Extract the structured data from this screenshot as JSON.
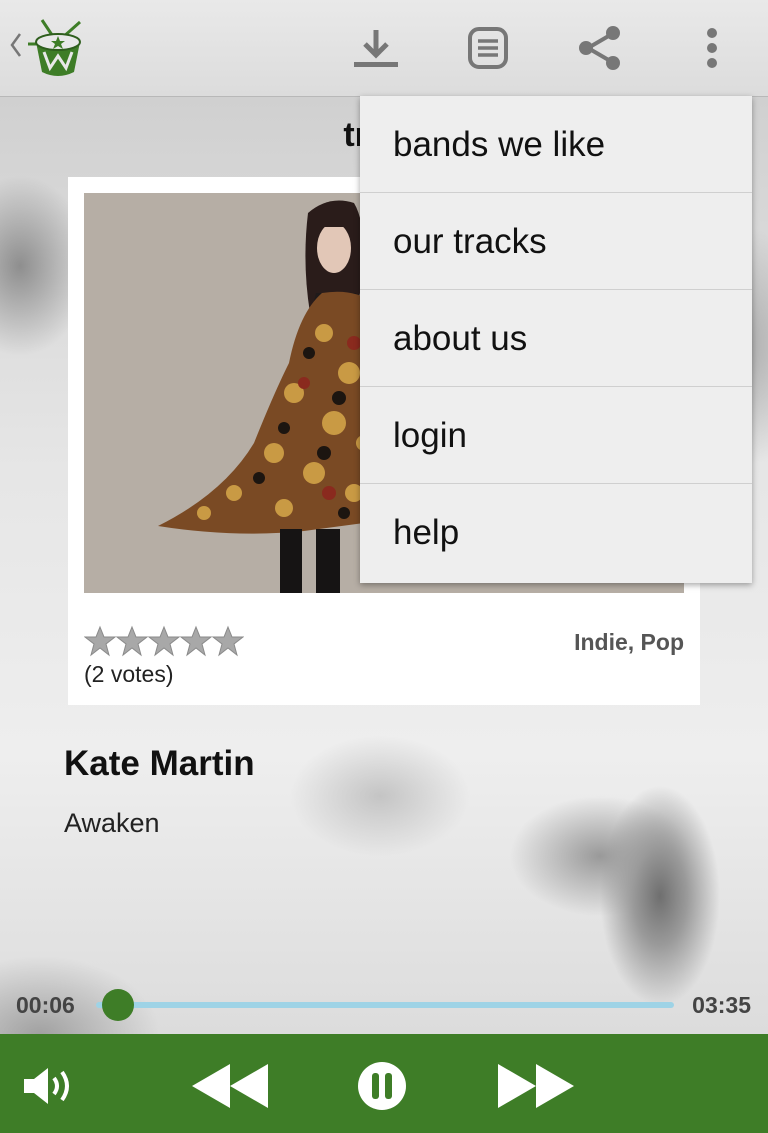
{
  "header": {
    "actions": [
      {
        "icon": "download-icon"
      },
      {
        "icon": "lyrics-icon"
      },
      {
        "icon": "share-icon"
      },
      {
        "icon": "overflow-menu-icon"
      }
    ]
  },
  "page": {
    "title": "track"
  },
  "track": {
    "rating": {
      "stars_filled": 0,
      "stars_total": 5,
      "votes_label": "(2 votes)"
    },
    "genres": "Indie, Pop",
    "artist": "Kate Martin",
    "title": "Awaken"
  },
  "player": {
    "elapsed": "00:06",
    "duration": "03:35",
    "progress_fraction": 0.03,
    "accent_color": "#3e7d27",
    "progress_color": "#9ed3e6",
    "controls": [
      {
        "icon": "volume-icon"
      },
      {
        "icon": "rewind-icon"
      },
      {
        "icon": "pause-icon"
      },
      {
        "icon": "fast-forward-icon"
      }
    ]
  },
  "overflow_menu": {
    "items": [
      "bands we like",
      "our tracks",
      "about us",
      "login",
      "help"
    ]
  }
}
